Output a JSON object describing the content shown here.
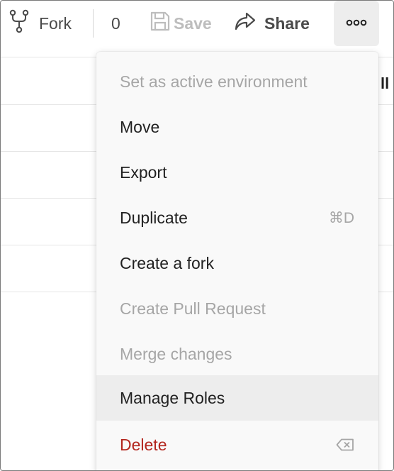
{
  "toolbar": {
    "fork_label": "Fork",
    "fork_count": "0",
    "save_label": "Save",
    "share_label": "Share",
    "more_icon": "more-horizontal-icon"
  },
  "row_edge_text": "ll",
  "menu": {
    "items": [
      {
        "label": "Set as active environment",
        "shortcut": "",
        "state": "disabled"
      },
      {
        "label": "Move",
        "shortcut": "",
        "state": "normal"
      },
      {
        "label": "Export",
        "shortcut": "",
        "state": "normal"
      },
      {
        "label": "Duplicate",
        "shortcut": "⌘D",
        "state": "normal"
      },
      {
        "label": "Create a fork",
        "shortcut": "",
        "state": "normal"
      },
      {
        "label": "Create Pull Request",
        "shortcut": "",
        "state": "disabled"
      },
      {
        "label": "Merge changes",
        "shortcut": "",
        "state": "disabled"
      },
      {
        "label": "Manage Roles",
        "shortcut": "",
        "state": "hover"
      },
      {
        "label": "Delete",
        "shortcut": "",
        "shortcut_icon": "backspace-icon",
        "state": "danger"
      }
    ]
  },
  "colors": {
    "danger": "#b3261e",
    "disabled_text": "#a6a6a6",
    "hover_bg": "#ededed",
    "menu_bg": "#f9f9f9"
  }
}
